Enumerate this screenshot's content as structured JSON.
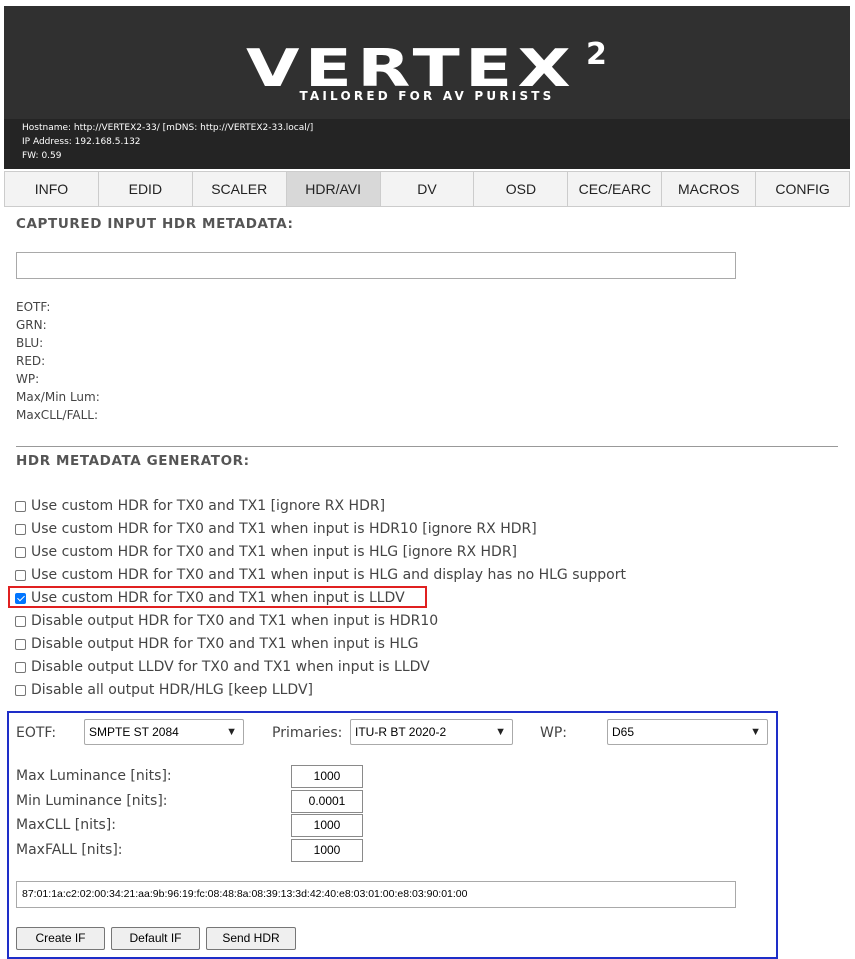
{
  "header": {
    "logo_text": "VERTEX",
    "logo_superscript": "2",
    "tagline": "TAILORED FOR AV PURISTS",
    "hostname_line": "Hostname: http://VERTEX2-33/ [mDNS: http://VERTEX2-33.local/]",
    "ip_line": "IP Address: 192.168.5.132",
    "fw_line": "FW: 0.59"
  },
  "tabs": [
    {
      "label": "INFO",
      "active": false
    },
    {
      "label": "EDID",
      "active": false
    },
    {
      "label": "SCALER",
      "active": false
    },
    {
      "label": "HDR/AVI",
      "active": true
    },
    {
      "label": "DV",
      "active": false
    },
    {
      "label": "OSD",
      "active": false
    },
    {
      "label": "CEC/EARC",
      "active": false
    },
    {
      "label": "MACROS",
      "active": false
    },
    {
      "label": "CONFIG",
      "active": false
    }
  ],
  "captured": {
    "title": "CAPTURED INPUT HDR METADATA:",
    "raw_value": "",
    "fields": [
      "EOTF:",
      "GRN:",
      "BLU:",
      "RED:",
      "WP:",
      "Max/Min Lum:",
      "MaxCLL/FALL:"
    ]
  },
  "generator": {
    "title": "HDR METADATA GENERATOR:",
    "options": [
      {
        "label": "Use custom HDR for TX0 and TX1 [ignore RX HDR]",
        "checked": false
      },
      {
        "label": "Use custom HDR for TX0 and TX1 when input is HDR10 [ignore RX HDR]",
        "checked": false
      },
      {
        "label": "Use custom HDR for TX0 and TX1 when input is HLG [ignore RX HDR]",
        "checked": false
      },
      {
        "label": "Use custom HDR for TX0 and TX1 when input is HLG and display has no HLG support",
        "checked": false
      },
      {
        "label": "Use custom HDR for TX0 and TX1 when input is LLDV",
        "checked": true
      },
      {
        "label": "Disable output HDR for TX0 and TX1 when input is HDR10",
        "checked": false
      },
      {
        "label": "Disable output HDR for TX0 and TX1 when input is HLG",
        "checked": false
      },
      {
        "label": "Disable output LLDV for TX0 and TX1 when input is LLDV",
        "checked": false
      },
      {
        "label": "Disable all output HDR/HLG [keep LLDV]",
        "checked": false
      }
    ],
    "eotf_label": "EOTF:",
    "eotf_value": "SMPTE ST 2084",
    "primaries_label": "Primaries:",
    "primaries_value": "ITU-R BT 2020-2",
    "wp_label": "WP:",
    "wp_value": "D65",
    "max_lum_label": "Max Luminance [nits]:",
    "max_lum_value": "1000",
    "min_lum_label": "Min Luminance [nits]:",
    "min_lum_value": "0.0001",
    "maxcll_label": "MaxCLL [nits]:",
    "maxcll_value": "1000",
    "maxfall_label": "MaxFALL [nits]:",
    "maxfall_value": "1000",
    "infoframe_hex": "87:01:1a:c2:02:00:34:21:aa:9b:96:19:fc:08:48:8a:08:39:13:3d:42:40:e8:03:01:00:e8:03:90:01:00",
    "buttons": {
      "create": "Create IF",
      "default": "Default IF",
      "send": "Send HDR"
    }
  },
  "colors": {
    "header_bg": "#303030",
    "info_bg": "#242424",
    "active_tab": "#d8d8d8",
    "highlight_red": "#e02020",
    "highlight_blue": "#1e2ec8",
    "checkbox_checked": "#0075ff"
  },
  "icons": {
    "dropdown": "chevron-down-icon",
    "checkmark": "checkmark-icon"
  }
}
